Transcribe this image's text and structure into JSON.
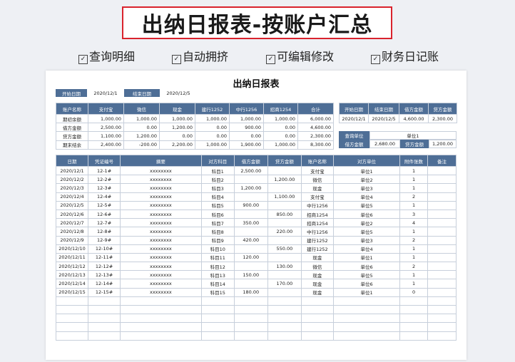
{
  "banner": {
    "title": "出纳日报表-按账户汇总"
  },
  "features": [
    "查询明细",
    "自动拥挤",
    "可编辑修改",
    "财务日记账"
  ],
  "sheet": {
    "title": "出纳日报表",
    "start_label": "开始日期",
    "start_value": "2020/12/1",
    "end_label": "结束日期",
    "end_value": "2020/12/5"
  },
  "summary": {
    "headers": [
      "账户名称",
      "支付宝",
      "微信",
      "现金",
      "建行1252",
      "中行1256",
      "招商1254",
      "合计"
    ],
    "rows": [
      [
        "期初余额",
        "1,000.00",
        "1,000.00",
        "1,000.00",
        "1,000.00",
        "1,000.00",
        "1,000.00",
        "6,000.00"
      ],
      [
        "借方金额",
        "2,500.00",
        "0.00",
        "1,200.00",
        "0.00",
        "900.00",
        "0.00",
        "4,600.00"
      ],
      [
        "贷方金额",
        "1,100.00",
        "1,200.00",
        "0.00",
        "0.00",
        "0.00",
        "0.00",
        "2,300.00"
      ],
      [
        "期末结余",
        "2,400.00",
        "-200.00",
        "2,200.00",
        "1,000.00",
        "1,900.00",
        "1,000.00",
        "8,300.00"
      ]
    ]
  },
  "right_summary": {
    "headers": [
      "开始日期",
      "结束日期",
      "借方金额",
      "贷方金额"
    ],
    "values": [
      "2020/12/1",
      "2020/12/5",
      "4,600.00",
      "2,300.00"
    ]
  },
  "query": {
    "label": "查询单位",
    "value": "单位1",
    "debit_label": "借方金额",
    "debit_value": "2,680.00",
    "credit_label": "贷方金额",
    "credit_value": "1,200.00"
  },
  "detail": {
    "headers": [
      "日期",
      "凭证编号",
      "摘要",
      "对方科目",
      "借方金额",
      "贷方金额",
      "账户名称",
      "对方单位",
      "附件张数",
      "备注"
    ],
    "rows": [
      [
        "2020/12/1",
        "12-1#",
        "xxxxxxxx",
        "科目1",
        "2,500.00",
        "",
        "支付宝",
        "单位1",
        "1",
        ""
      ],
      [
        "2020/12/2",
        "12-2#",
        "xxxxxxxx",
        "科目2",
        "",
        "1,200.00",
        "微信",
        "单位2",
        "1",
        ""
      ],
      [
        "2020/12/3",
        "12-3#",
        "xxxxxxxx",
        "科目3",
        "1,200.00",
        "",
        "现金",
        "单位3",
        "1",
        ""
      ],
      [
        "2020/12/4",
        "12-4#",
        "xxxxxxxx",
        "科目4",
        "",
        "1,100.00",
        "支付宝",
        "单位4",
        "2",
        ""
      ],
      [
        "2020/12/5",
        "12-5#",
        "xxxxxxxx",
        "科目5",
        "900.00",
        "",
        "中行1256",
        "单位5",
        "1",
        ""
      ],
      [
        "2020/12/6",
        "12-6#",
        "xxxxxxxx",
        "科目6",
        "",
        "850.00",
        "招商1254",
        "单位6",
        "3",
        ""
      ],
      [
        "2020/12/7",
        "12-7#",
        "xxxxxxxx",
        "科目7",
        "350.00",
        "",
        "招商1254",
        "单位2",
        "4",
        ""
      ],
      [
        "2020/12/8",
        "12-8#",
        "xxxxxxxx",
        "科目8",
        "",
        "220.00",
        "中行1256",
        "单位5",
        "1",
        ""
      ],
      [
        "2020/12/9",
        "12-9#",
        "xxxxxxxx",
        "科目9",
        "420.00",
        "",
        "建行1252",
        "单位3",
        "2",
        ""
      ],
      [
        "2020/12/10",
        "12-10#",
        "xxxxxxxx",
        "科目10",
        "",
        "550.00",
        "建行1252",
        "单位4",
        "1",
        ""
      ],
      [
        "2020/12/11",
        "12-11#",
        "xxxxxxxx",
        "科目11",
        "120.00",
        "",
        "现金",
        "单位1",
        "1",
        ""
      ],
      [
        "2020/12/12",
        "12-12#",
        "xxxxxxxx",
        "科目12",
        "",
        "130.00",
        "微信",
        "单位6",
        "2",
        ""
      ],
      [
        "2020/12/13",
        "12-13#",
        "xxxxxxxx",
        "科目13",
        "150.00",
        "",
        "现金",
        "单位5",
        "1",
        ""
      ],
      [
        "2020/12/14",
        "12-14#",
        "xxxxxxxx",
        "科目14",
        "",
        "170.00",
        "现金",
        "单位6",
        "1",
        ""
      ],
      [
        "2020/12/15",
        "12-15#",
        "xxxxxxxx",
        "科目15",
        "180.00",
        "",
        "现金",
        "单位1",
        "0",
        ""
      ]
    ],
    "empty_rows": 5
  },
  "colors": {
    "header": "#4e6e96",
    "debit": "#2f4f86",
    "credit": "#a0333f",
    "banner_border": "#d9232d"
  }
}
